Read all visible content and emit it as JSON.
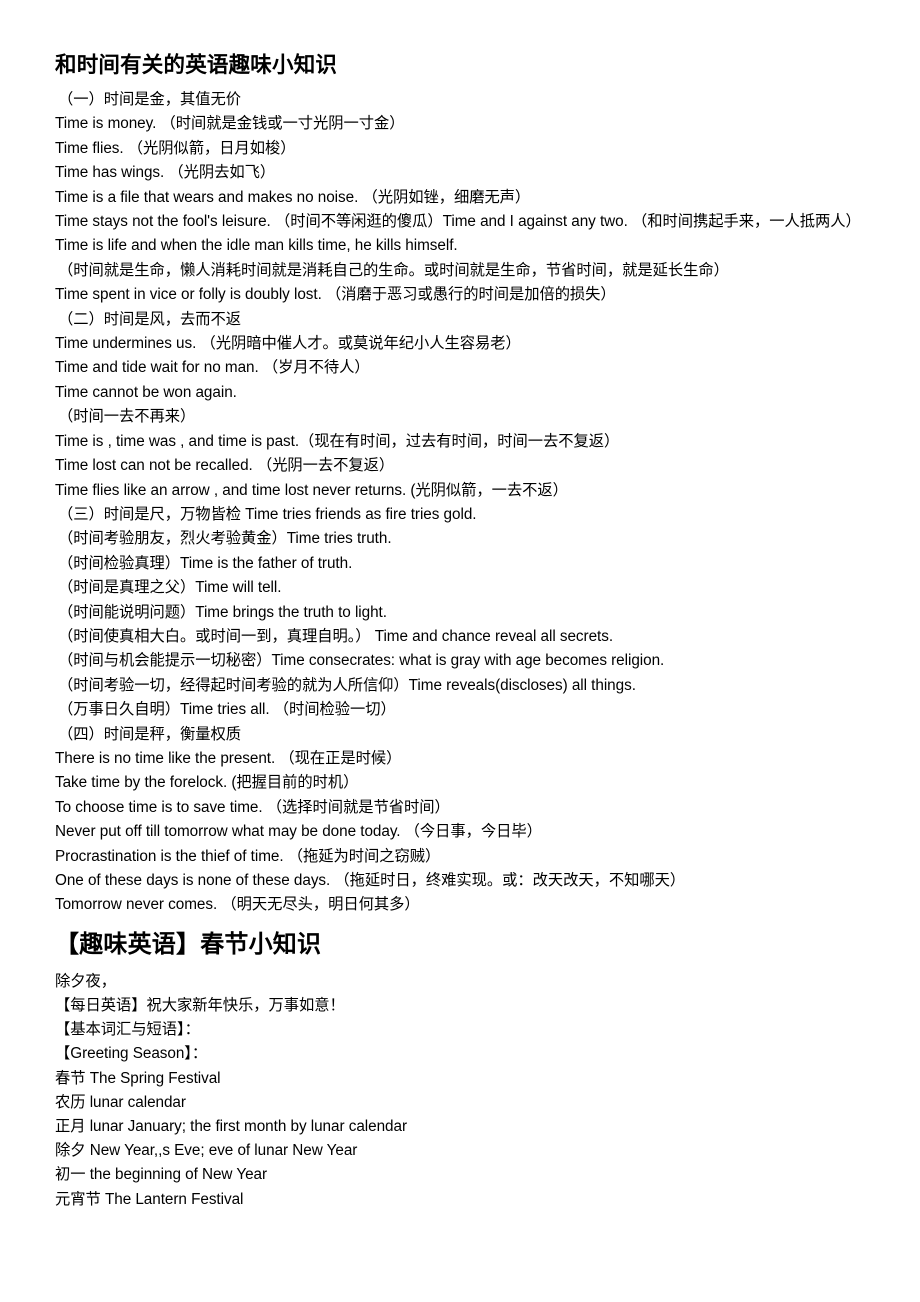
{
  "document": {
    "title": "和时间有关的英语趣味小知识"
  },
  "time_section": {
    "heading": "和时间有关的英语趣味小知识",
    "lines": [
      {
        "text": "（一）时间是金，其值无价",
        "indent": true
      },
      {
        "text": "Time is money. （时间就是金钱或一寸光阴一寸金）",
        "indent": false
      },
      {
        "text": "Time flies. （光阴似箭，日月如梭）",
        "indent": false
      },
      {
        "text": "Time has wings. （光阴去如飞）",
        "indent": false
      },
      {
        "text": "Time is a file that wears and makes no noise. （光阴如锉，细磨无声）",
        "indent": false
      },
      {
        "text": "Time stays not the fool's leisure. （时间不等闲逛的傻瓜）Time and I against any two. （和时间携起手来，一人抵两人）",
        "indent": false
      },
      {
        "text": "Time is life and when the idle man kills time, he kills himself.",
        "indent": false
      },
      {
        "text": "（时间就是生命，懒人消耗时间就是消耗自己的生命。或时间就是生命，节省时间，就是延长生命）",
        "indent": true
      },
      {
        "text": "Time spent in vice or folly is doubly lost. （消磨于恶习或愚行的时间是加倍的损失）",
        "indent": false
      },
      {
        "text": "（二）时间是风，去而不返",
        "indent": true
      },
      {
        "text": "Time undermines us. （光阴暗中催人才。或莫说年纪小人生容易老）",
        "indent": false
      },
      {
        "text": "Time and tide wait for no man. （岁月不待人）",
        "indent": false
      },
      {
        "text": "Time cannot be won again.",
        "indent": false
      },
      {
        "text": "（时间一去不再来）",
        "indent": true
      },
      {
        "text": "Time is , time was , and time is past.（现在有时间，过去有时间，时间一去不复返）",
        "indent": false
      },
      {
        "text": "Time lost can not be recalled. （光阴一去不复返）",
        "indent": false
      },
      {
        "text": "Time flies like an arrow , and time lost never returns. (光阴似箭，一去不返）",
        "indent": false
      },
      {
        "text": "（三）时间是尺，万物皆检 Time tries friends as fire tries gold.",
        "indent": true
      },
      {
        "text": "（时间考验朋友，烈火考验黄金）Time tries truth.",
        "indent": true
      },
      {
        "text": "（时间检验真理）Time is the father of truth.",
        "indent": true
      },
      {
        "text": "（时间是真理之父）Time will tell.",
        "indent": true
      },
      {
        "text": "（时间能说明问题）Time brings the truth to light.",
        "indent": true
      },
      {
        "text": "（时间使真相大白。或时间一到，真理自明。） Time and chance reveal all secrets.",
        "indent": true
      },
      {
        "text": "（时间与机会能提示一切秘密）Time consecrates: what is gray with age becomes religion.",
        "indent": true
      },
      {
        "text": "（时间考验一切，经得起时间考验的就为人所信仰）Time reveals(discloses) all things.",
        "indent": true
      },
      {
        "text": "（万事日久自明）Time tries all. （时间检验一切）",
        "indent": true
      },
      {
        "text": "（四）时间是秤，衡量权质",
        "indent": true
      },
      {
        "text": "There is no time like the present. （现在正是时候）",
        "indent": false
      },
      {
        "text": "Take time by the forelock. (把握目前的时机）",
        "indent": false
      },
      {
        "text": "To choose time is to save time. （选择时间就是节省时间）",
        "indent": false
      },
      {
        "text": "Never put off till tomorrow what may be done today. （今日事，今日毕）",
        "indent": false
      },
      {
        "text": "Procrastination is the thief of time. （拖延为时间之窃贼）",
        "indent": false
      },
      {
        "text": "One of these days is none of these days. （拖延时日，终难实现。或：改天改天，不知哪天）",
        "indent": false
      },
      {
        "text": "Tomorrow never comes. （明天无尽头，明日何其多）",
        "indent": false
      }
    ]
  },
  "festival_section": {
    "heading": "【趣味英语】春节小知识",
    "lines": [
      {
        "text": "除夕夜，",
        "indent": false
      },
      {
        "text": "【每日英语】祝大家新年快乐，万事如意！",
        "indent": false
      },
      {
        "text": "【基本词汇与短语】：",
        "indent": false
      },
      {
        "text": "【Greeting Season】：",
        "indent": false
      },
      {
        "text": "春节 The Spring Festival",
        "indent": false
      },
      {
        "text": "农历 lunar calendar",
        "indent": false
      },
      {
        "text": "正月 lunar January; the first month by lunar calendar",
        "indent": false
      },
      {
        "text": "除夕 New Year,,s Eve; eve of lunar New Year",
        "indent": false
      },
      {
        "text": "初一 the beginning of New Year",
        "indent": false
      },
      {
        "text": "元宵节 The Lantern Festival",
        "indent": false
      }
    ]
  }
}
